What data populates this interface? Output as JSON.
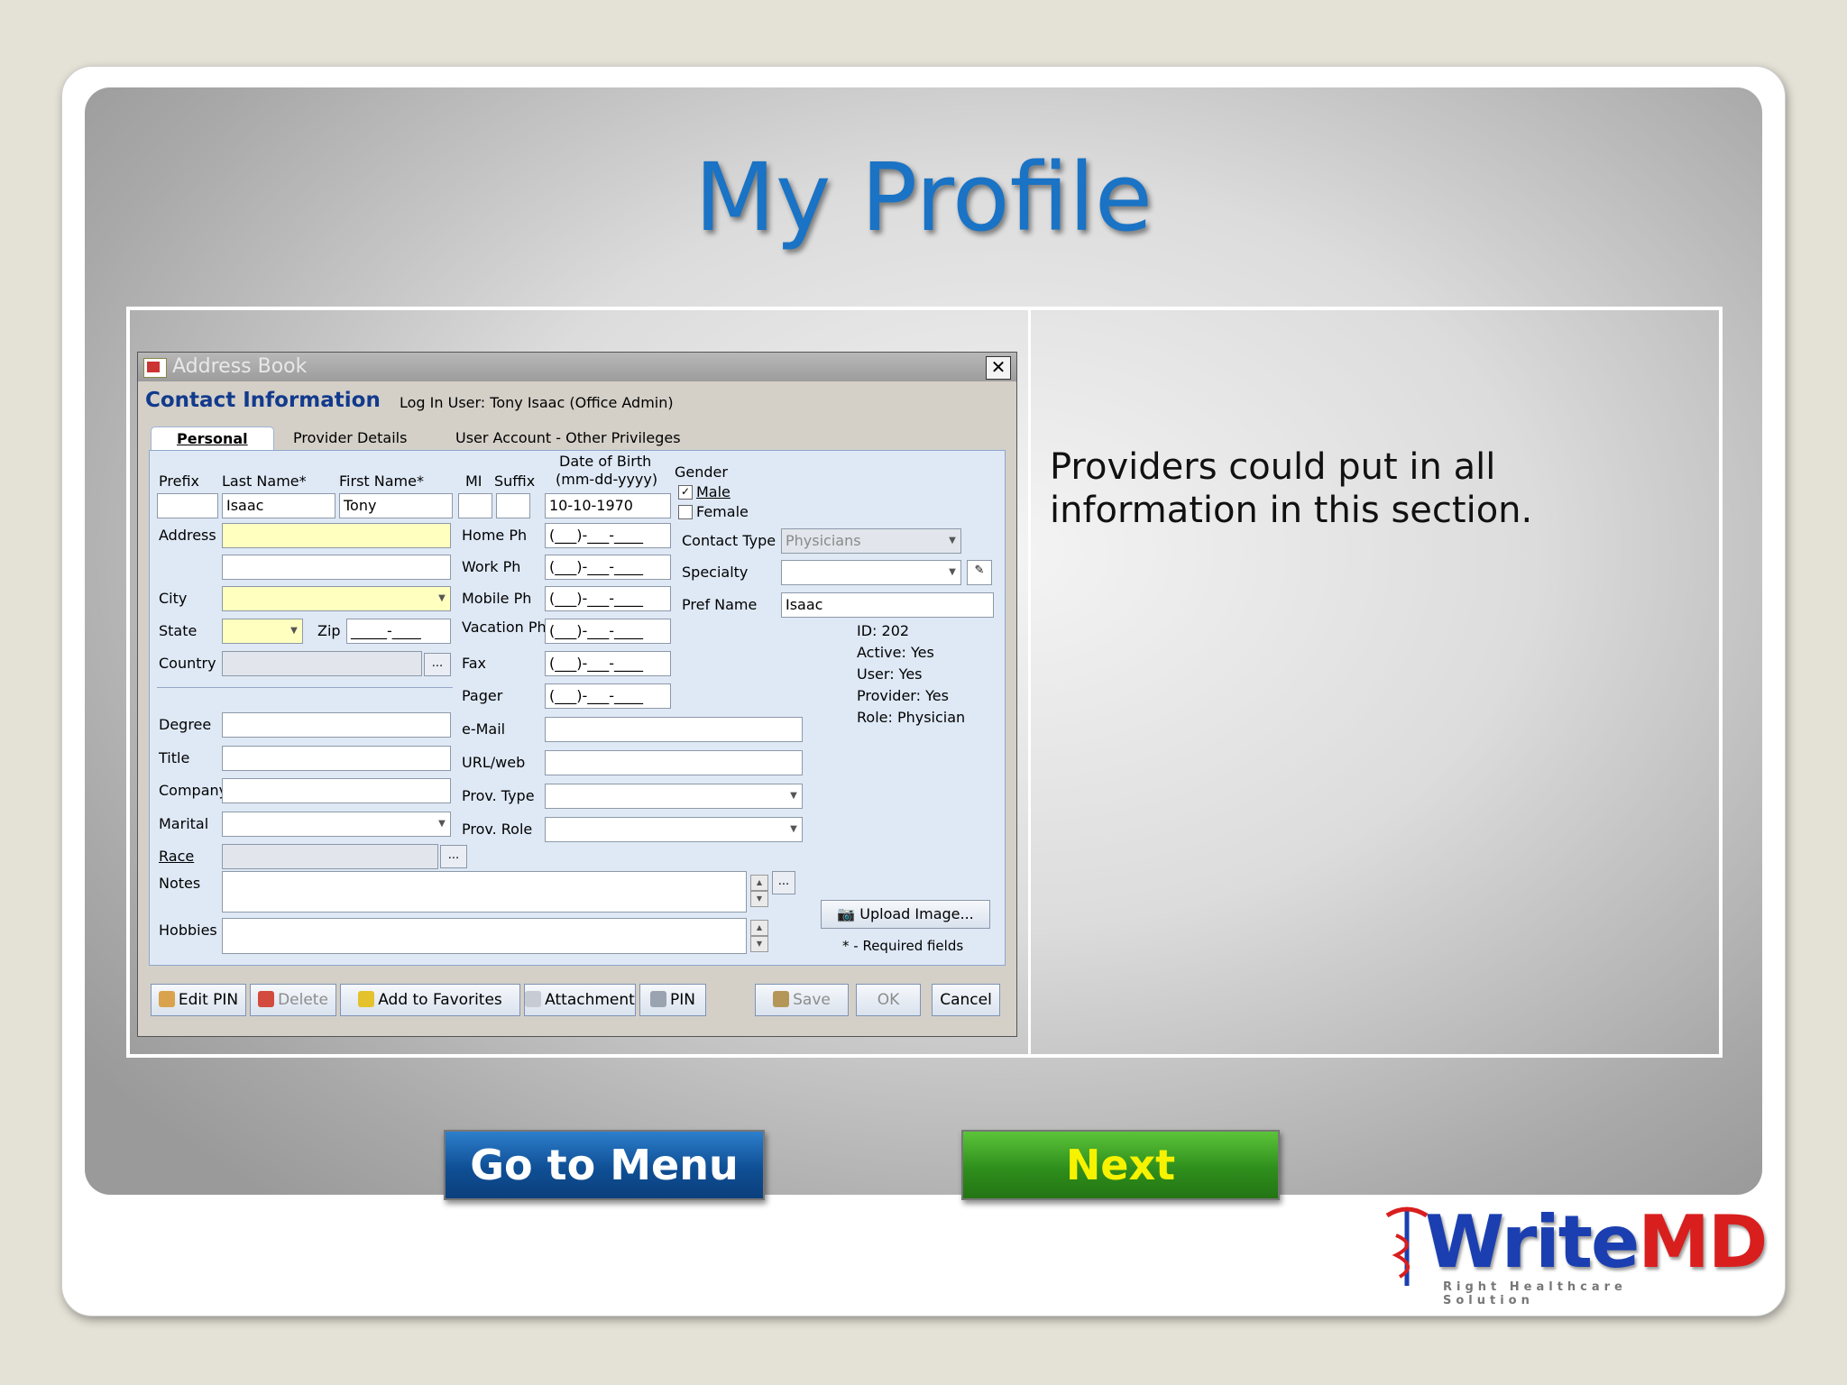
{
  "slide": {
    "title": "My Profile",
    "description": "Providers could put in all information in this section.",
    "menu_button": "Go to Menu",
    "next_button": "Next",
    "logo": {
      "text_main": "Write",
      "text_accent": "MD",
      "tagline": "Right Healthcare Solution",
      "color_main": "#1b3fb0",
      "color_accent": "#d91e1e"
    }
  },
  "dialog": {
    "title": "Address Book",
    "header": "Contact Information",
    "login_user": "Log In User:  Tony  Isaac (Office Admin)",
    "tabs": [
      {
        "label": "Personal",
        "active": true
      },
      {
        "label": "Provider Details",
        "active": false
      },
      {
        "label": "User Account - Other Privileges",
        "active": false
      }
    ],
    "fields": {
      "prefix_label": "Prefix",
      "prefix_value": "",
      "last_name_label": "Last Name*",
      "last_name_value": "Isaac",
      "first_name_label": "First Name*",
      "first_name_value": "Tony",
      "mi_label": "MI",
      "mi_value": "",
      "suffix_label": "Suffix",
      "suffix_value": "",
      "dob_label_line1": "Date of Birth",
      "dob_label_line2": "(mm-dd-yyyy)",
      "dob_value": "10-10-1970",
      "gender_label": "Gender",
      "gender_male": "Male",
      "gender_female": "Female",
      "gender_male_checked": true,
      "address_label": "Address",
      "address_value": "",
      "address2_value": "",
      "city_label": "City",
      "city_value": "",
      "state_label": "State",
      "state_value": "",
      "zip_label": "Zip",
      "zip_value": "_____-____",
      "country_label": "Country",
      "country_value": "",
      "degree_label": "Degree",
      "title_label": "Title",
      "company_label": "Company",
      "marital_label": "Marital",
      "race_label": "Race",
      "notes_label": "Notes",
      "hobbies_label": "Hobbies",
      "home_ph_label": "Home Ph",
      "work_ph_label": "Work Ph",
      "mobile_ph_label": "Mobile Ph",
      "vacation_ph_label": "Vacation Ph",
      "fax_label": "Fax",
      "pager_label": "Pager",
      "phone_mask": "(___)-___-____",
      "email_label": "e-Mail",
      "url_label": "URL/web",
      "prov_type_label": "Prov. Type",
      "prov_role_label": "Prov. Role",
      "contact_type_label": "Contact Type",
      "contact_type_value": "Physicians",
      "specialty_label": "Specialty",
      "specialty_value": "",
      "pref_name_label": "Pref Name",
      "pref_name_value": "Isaac",
      "browse_label": "..."
    },
    "info": {
      "id": "ID:  202",
      "active": "Active: Yes",
      "user": "User: Yes",
      "provider": "Provider: Yes",
      "role": "Role: Physician"
    },
    "upload_image": "Upload Image...",
    "required_note": "* - Required fields",
    "buttons": {
      "edit_pin": "Edit PIN",
      "delete": "Delete",
      "add_favorites": "Add to Favorites",
      "attachment": "Attachment",
      "pin": "PIN",
      "save": "Save",
      "ok": "OK",
      "cancel": "Cancel"
    },
    "close_symbol": "✕"
  }
}
